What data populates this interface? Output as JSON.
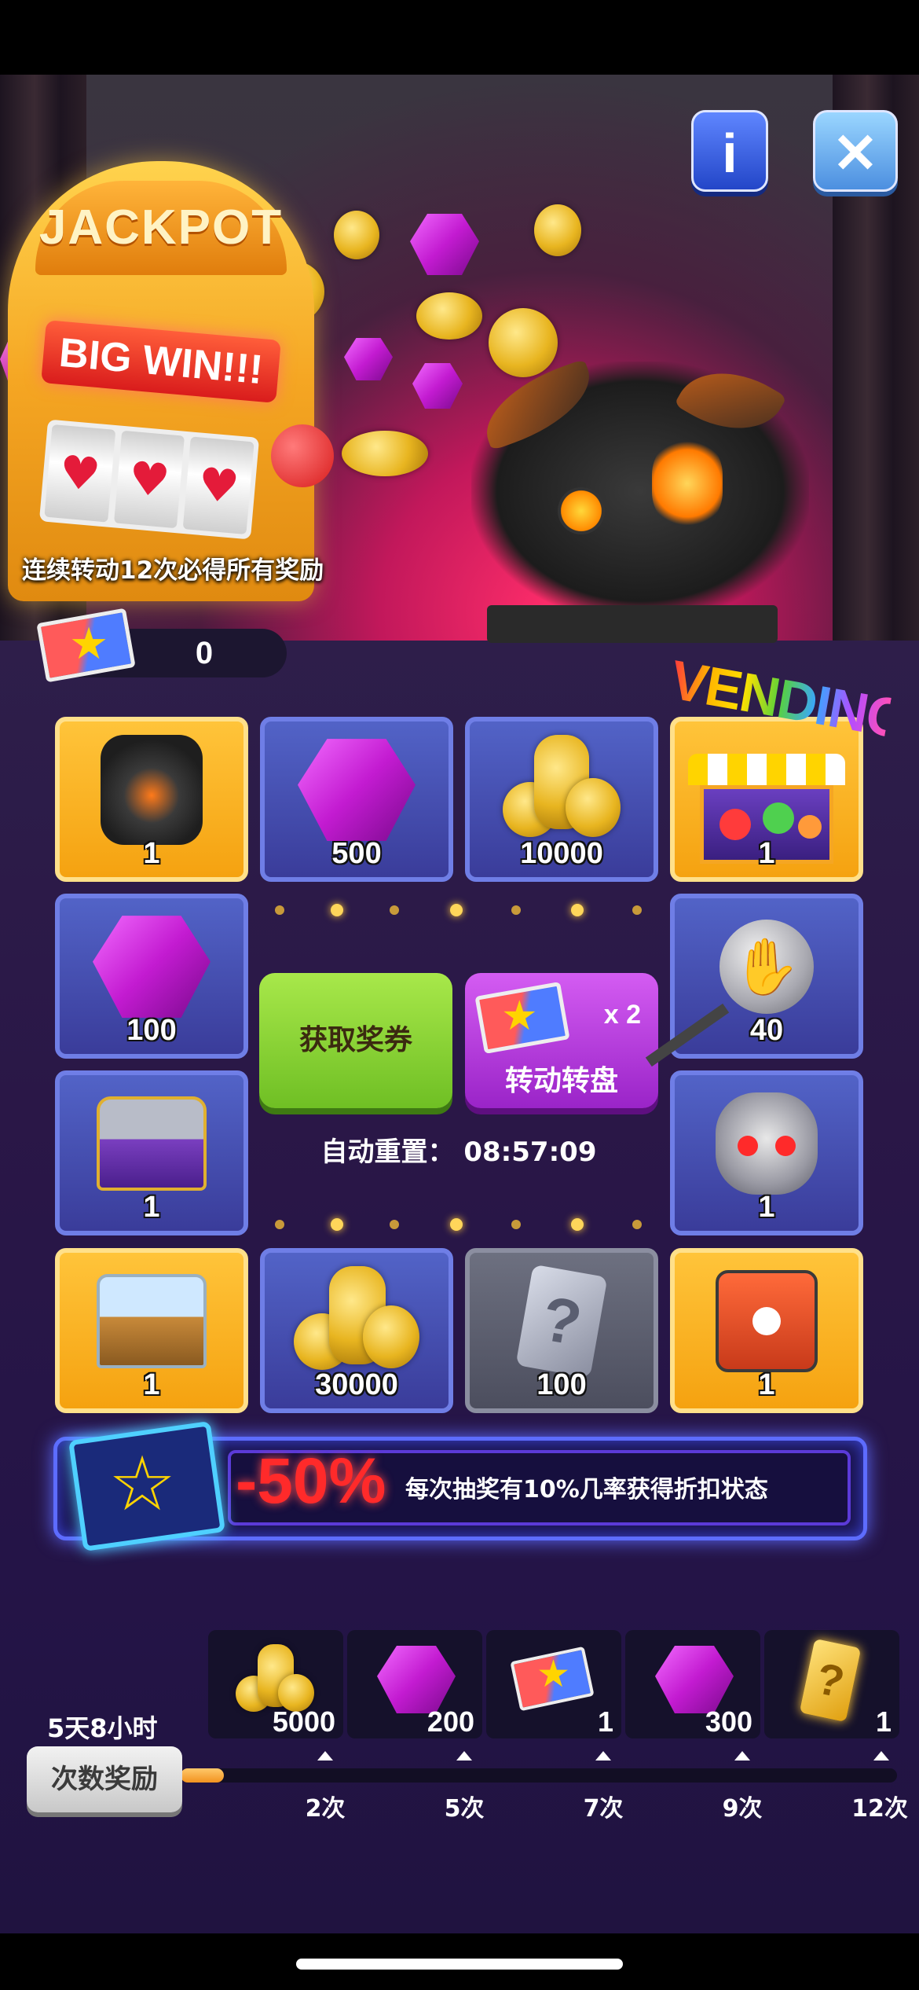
{
  "banner": {
    "jackpot_title": "JACKPOT",
    "big_win": "BIG WIN!!!",
    "caption": "连续转动12次必得所有奖励"
  },
  "top_buttons": {
    "info_label": "i",
    "close_label": "✕"
  },
  "tickets": {
    "count": "0"
  },
  "vending_sign": "VENDING",
  "grid": {
    "row1": [
      {
        "name": "lava-dragon-tank",
        "value": "1",
        "style": "gold",
        "icon": "tank-icon"
      },
      {
        "name": "gems",
        "value": "500",
        "style": "blue",
        "icon": "gems-icon"
      },
      {
        "name": "gold-coins",
        "value": "10000",
        "style": "blue",
        "icon": "coins-icon"
      },
      {
        "name": "vending-machine",
        "value": "1",
        "style": "gold",
        "icon": "vending-icon"
      }
    ],
    "left_col": [
      {
        "name": "gems",
        "value": "100",
        "style": "blue",
        "icon": "gems-icon"
      },
      {
        "name": "treasure-chest",
        "value": "1",
        "style": "blue",
        "icon": "chest-icon"
      }
    ],
    "right_col": [
      {
        "name": "alliance-token",
        "value": "40",
        "style": "blue",
        "icon": "handshake-icon"
      },
      {
        "name": "bunny-robot",
        "value": "1",
        "style": "blue",
        "icon": "bunny-robot-icon"
      }
    ],
    "row4": [
      {
        "name": "frozen-chest",
        "value": "1",
        "style": "gold",
        "icon": "chest-icon"
      },
      {
        "name": "gold-coins",
        "value": "30000",
        "style": "blue",
        "icon": "coins-icon"
      },
      {
        "name": "mystery-card",
        "value": "100",
        "style": "gray",
        "icon": "question-card-icon"
      },
      {
        "name": "red-crate",
        "value": "1",
        "style": "gold",
        "icon": "crate-icon"
      }
    ]
  },
  "center": {
    "get_button": "获取奖券",
    "spin_button": "转动转盘",
    "spin_multiplier": "x 2",
    "reset_label": "自动重置：",
    "reset_time": "08:57:09"
  },
  "discount": {
    "percent": "-50%",
    "text": "每次抽奖有10%几率获得折扣状态"
  },
  "milestones": {
    "timer": "5天8小时",
    "button": "次数奖励",
    "progress": 0.06,
    "items": [
      {
        "icon": "coins-icon",
        "value": "5000",
        "count": "2次"
      },
      {
        "icon": "gems-icon",
        "value": "200",
        "count": "5次"
      },
      {
        "icon": "ticket-icon",
        "value": "1",
        "count": "7次"
      },
      {
        "icon": "gems-icon",
        "value": "300",
        "count": "9次"
      },
      {
        "icon": "question-card-icon",
        "value": "1",
        "count": "12次"
      }
    ]
  },
  "colors": {
    "accent_gold": "#ffc43a",
    "accent_blue": "#5263c7",
    "discount_red": "#ff2a2a"
  }
}
